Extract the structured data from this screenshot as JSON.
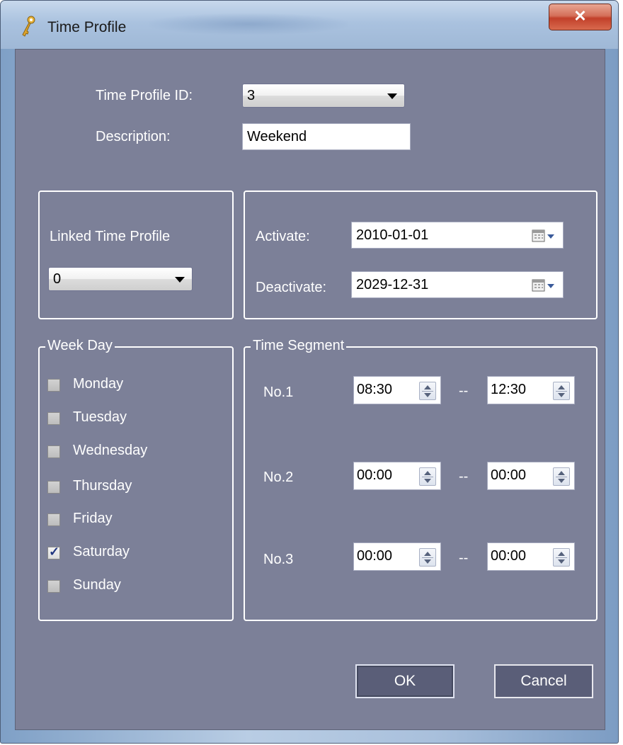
{
  "window": {
    "title": "Time Profile",
    "close_glyph": "✕"
  },
  "header": {
    "time_profile_id_label": "Time Profile ID:",
    "time_profile_id_value": "3",
    "description_label": "Description:",
    "description_value": "Weekend"
  },
  "linked": {
    "label": "Linked Time Profile",
    "value": "0"
  },
  "dates": {
    "activate_label": "Activate:",
    "activate_value": "2010-01-01",
    "deactivate_label": "Deactivate:",
    "deactivate_value": "2029-12-31"
  },
  "week_day": {
    "title": "Week Day",
    "days": [
      {
        "label": "Monday",
        "checked": false
      },
      {
        "label": "Tuesday",
        "checked": false
      },
      {
        "label": "Wednesday",
        "checked": false
      },
      {
        "label": "Thursday",
        "checked": false
      },
      {
        "label": "Friday",
        "checked": false
      },
      {
        "label": "Saturday",
        "checked": true
      },
      {
        "label": "Sunday",
        "checked": false
      }
    ]
  },
  "time_segment": {
    "title": "Time Segment",
    "separator": "--",
    "segments": [
      {
        "label": "No.1",
        "start": "08:30",
        "end": "12:30"
      },
      {
        "label": "No.2",
        "start": "00:00",
        "end": "00:00"
      },
      {
        "label": "No.3",
        "start": "00:00",
        "end": "00:00"
      }
    ]
  },
  "buttons": {
    "ok": "OK",
    "cancel": "Cancel"
  },
  "icons": {
    "app": "key-user-icon",
    "date_picker": "calendar-dropdown-icon",
    "spinner": "spinner-arrows-icon"
  }
}
